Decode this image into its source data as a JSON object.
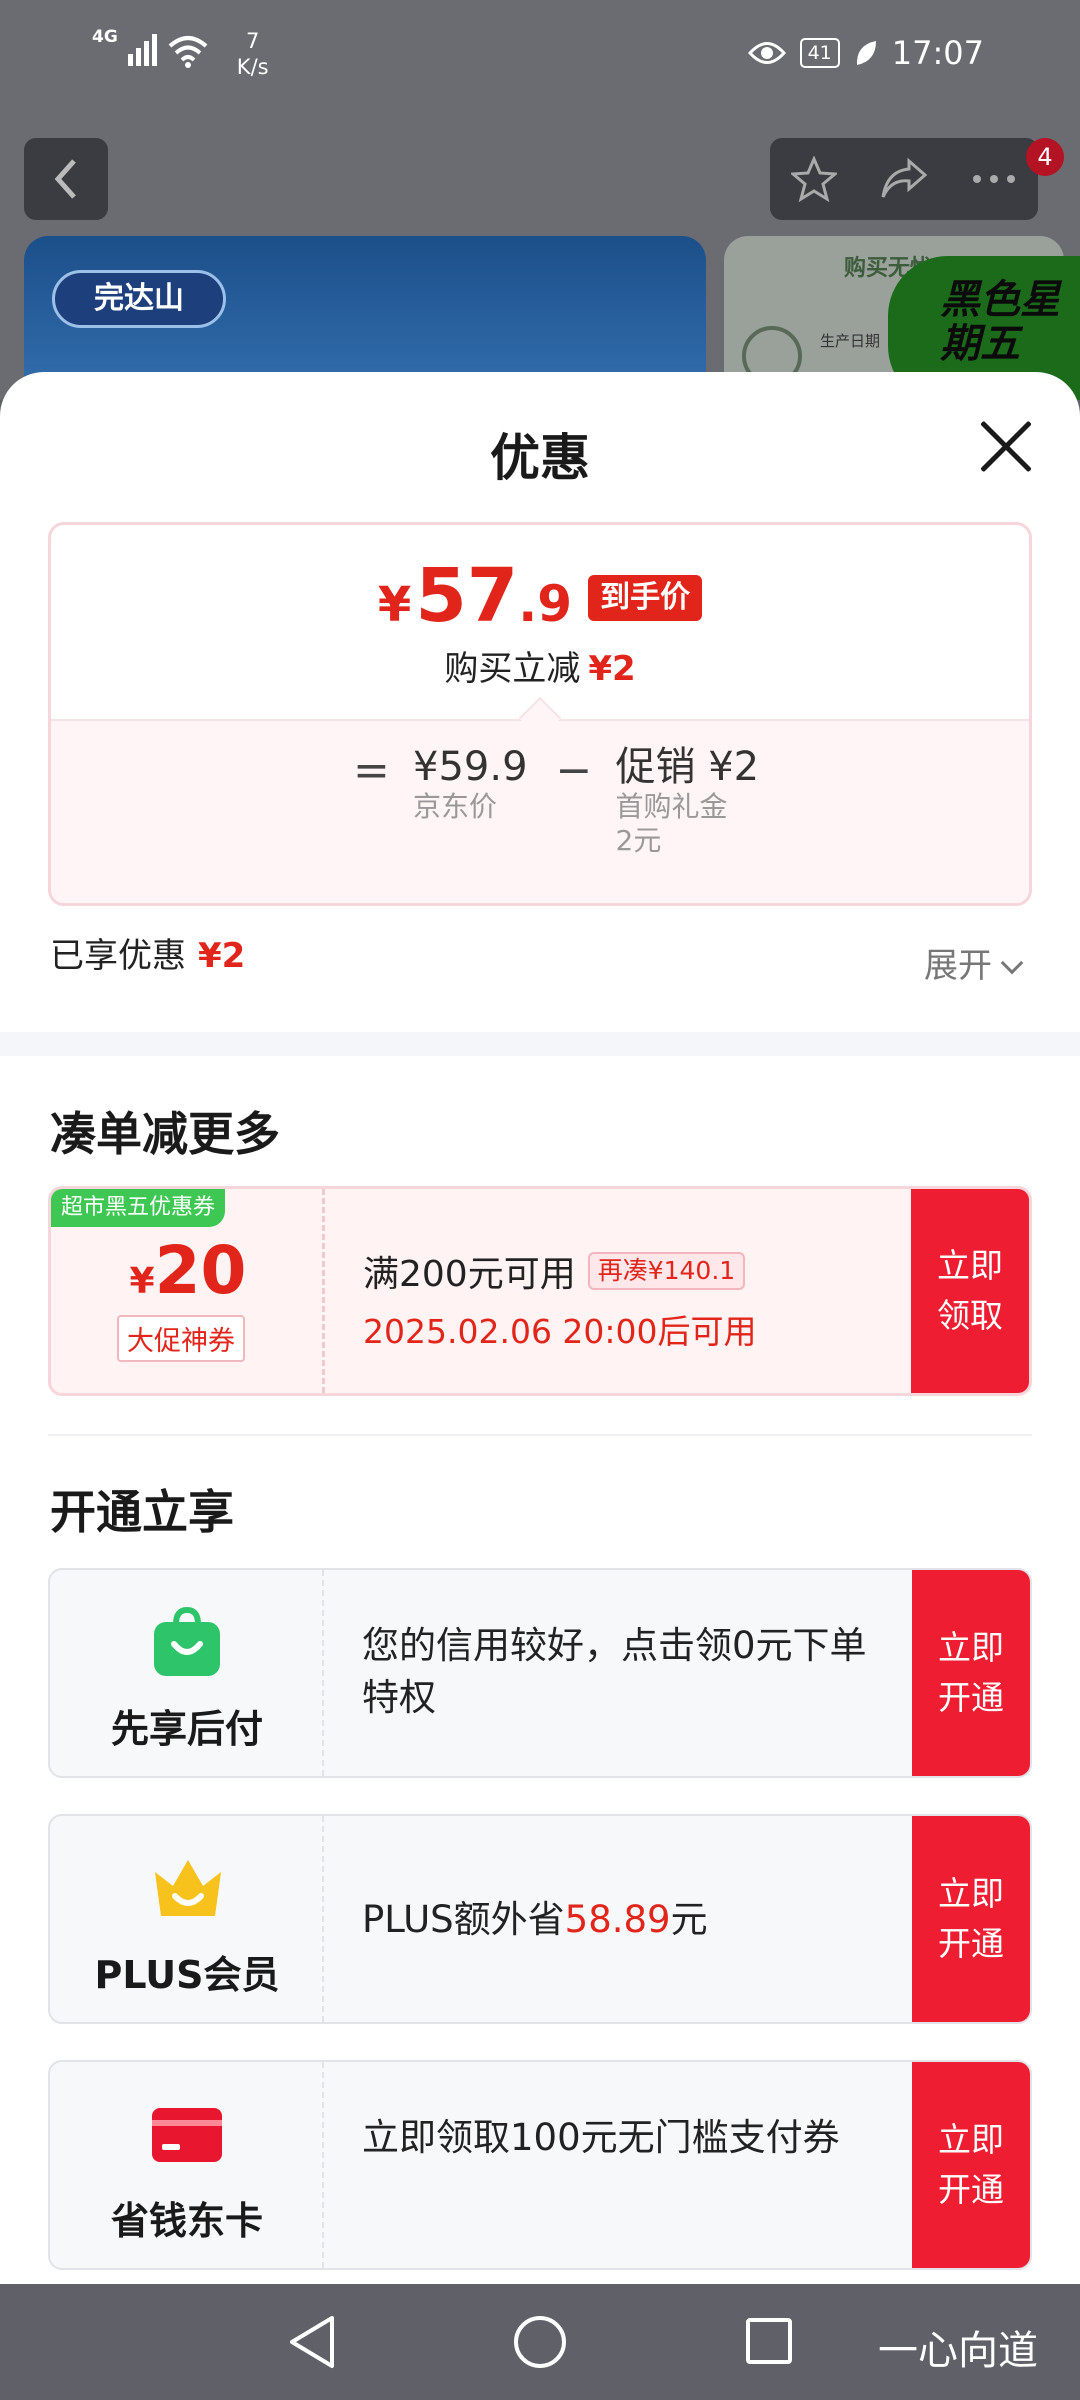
{
  "status_bar": {
    "network": "4G",
    "speed_value": "7",
    "speed_unit": "K/s",
    "battery": "41",
    "time": "17:07"
  },
  "background": {
    "notification_count": "4",
    "brand_logo": "完达山",
    "right_card_title": "购买无忧",
    "right_card_text": "生产日期",
    "promo_banner": "黑色星期五"
  },
  "sheet": {
    "title": "优惠"
  },
  "price": {
    "currency": "¥",
    "integer": "57",
    "decimal": ".9",
    "tag": "到手价",
    "reduce_label": "购买立减",
    "reduce_amount": "¥2",
    "equals": "=",
    "jd_price": "¥59.9",
    "jd_price_label": "京东价",
    "minus": "−",
    "promo": "促销 ¥2",
    "promo_detail": "首购礼金",
    "promo_detail2": "2元"
  },
  "enjoyed": {
    "label": "已享优惠",
    "amount": "¥2",
    "expand_label": "展开"
  },
  "section_coupons": {
    "title": "凑单减更多",
    "coupon": {
      "badge": "超市黑五优惠券",
      "currency": "¥",
      "amount": "20",
      "type_tag": "大促神券",
      "condition": "满200元可用",
      "more_tag": "再凑¥140.1",
      "valid_time": "2025.02.06 20:00后可用",
      "button": "立即领取"
    }
  },
  "section_services": {
    "title": "开通立享",
    "items": [
      {
        "name": "先享后付",
        "icon": "shopping-bag-icon",
        "text": "您的信用较好，点击领0元下单特权",
        "button": "立即开通"
      },
      {
        "name": "PLUS会员",
        "icon": "crown-icon",
        "text_prefix": "PLUS额外省",
        "highlight": "58.89",
        "text_suffix": "元",
        "button": "立即开通"
      },
      {
        "name": "省钱东卡",
        "icon": "card-icon",
        "text": "立即领取100元无门槛支付券",
        "button": "立即开通"
      }
    ]
  },
  "nav_bar": {
    "brand": "一心向道"
  },
  "colors": {
    "accent_red": "#e1251b",
    "button_red": "#ee1d31",
    "badge_green": "#3fc754",
    "icon_green": "#2ec46a",
    "crown_yellow": "#f7c21b",
    "card_red": "#e8162f"
  }
}
